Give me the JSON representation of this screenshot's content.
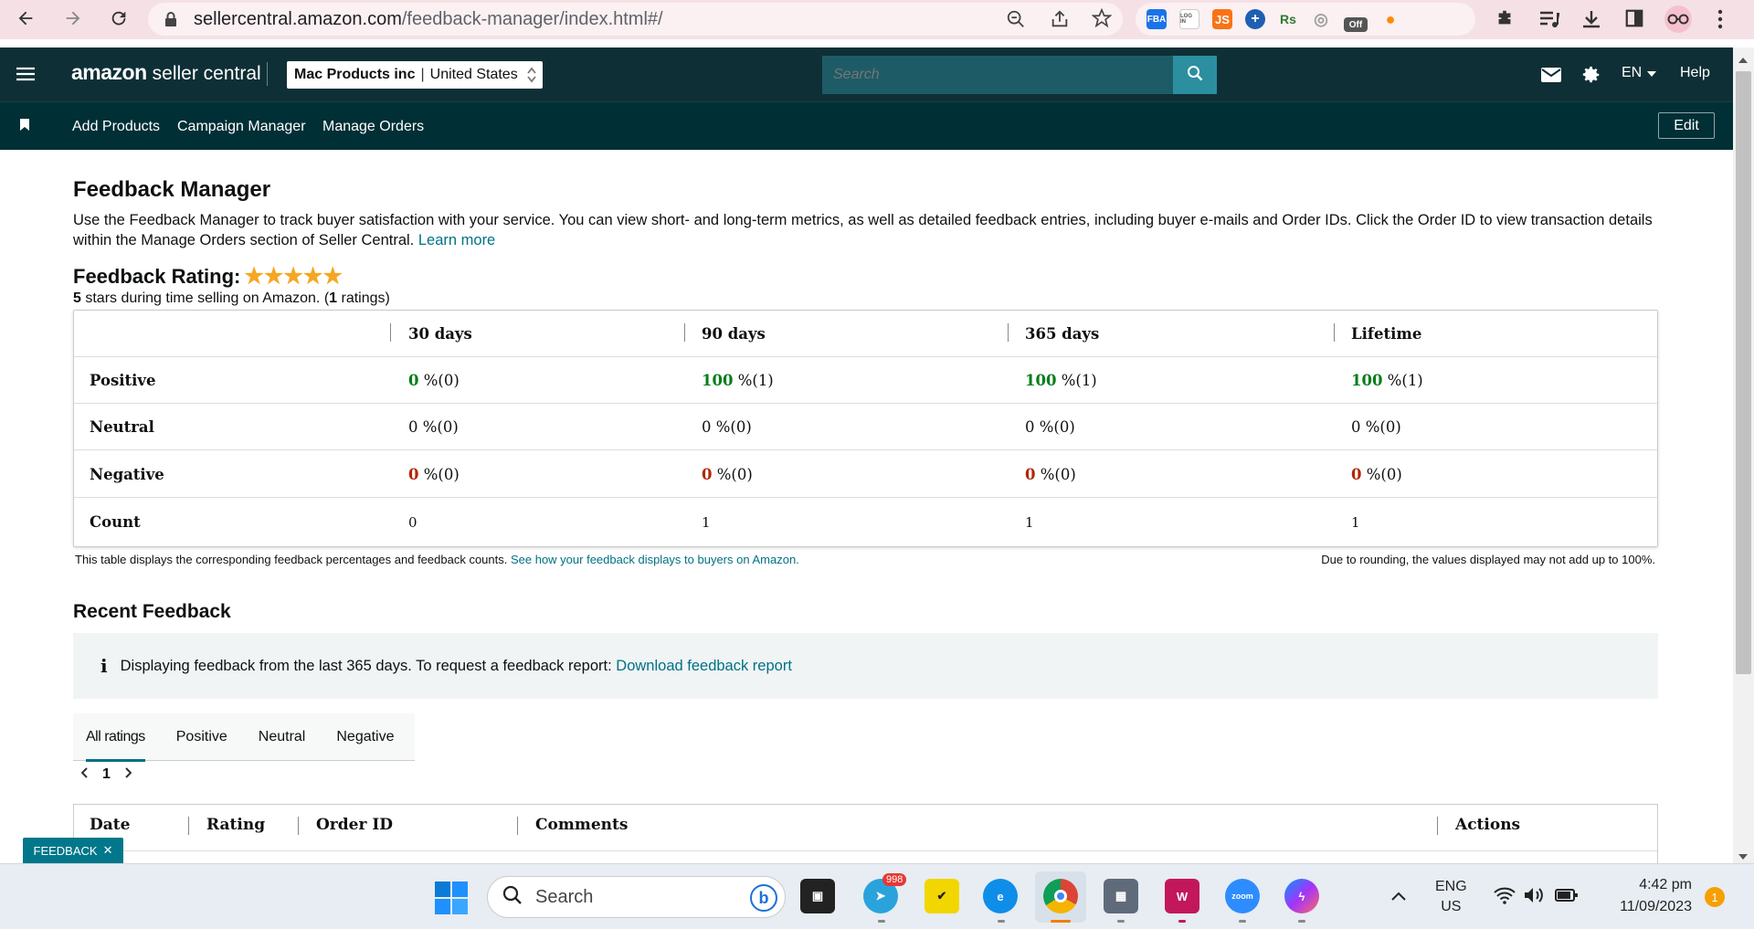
{
  "browser": {
    "url_host": "sellercentral.amazon.com",
    "url_path": "/feedback-manager/index.html#/",
    "extensions": [
      {
        "name": "fba-extension-icon",
        "label": "FBA",
        "color": "#1a73e8"
      },
      {
        "name": "login-extension-icon",
        "label": "LOG IN",
        "color": "#555555"
      },
      {
        "name": "js-extension-icon",
        "label": "JS",
        "color": "#f97316"
      },
      {
        "name": "plus-extension-icon",
        "label": "+",
        "color": "#1e5fb3"
      },
      {
        "name": "rs-extension-icon",
        "label": "Rs",
        "color": "#2e7d32"
      },
      {
        "name": "camera-extension-icon",
        "label": "◎",
        "color": "#9e9e9e"
      },
      {
        "name": "coffee-extension-icon",
        "label": "Off",
        "color": "#555555"
      },
      {
        "name": "orange-extension-icon",
        "label": "●",
        "color": "#ff8a00"
      }
    ]
  },
  "header": {
    "logo_main": "amazon",
    "logo_sub": "seller central",
    "account_name": "Mac Products inc",
    "account_region": "United States",
    "search_placeholder": "Search",
    "language": "EN",
    "help": "Help"
  },
  "subnav": {
    "items": [
      "Add Products",
      "Campaign Manager",
      "Manage Orders"
    ],
    "edit": "Edit"
  },
  "page": {
    "title": "Feedback Manager",
    "description": "Use the Feedback Manager to track buyer satisfaction with your service. You can view short- and long-term metrics, as well as detailed feedback entries, including buyer e-mails and Order IDs. Click the Order ID to view transaction details within the Manage Orders section of Seller Central.",
    "learn_more": "Learn more",
    "rating_label": "Feedback Rating:",
    "rating_stars": 5,
    "rating_sub_count": "5",
    "rating_sub_mid": " stars during time selling on Amazon. (",
    "rating_sub_ratings": "1",
    "rating_sub_end": " ratings)"
  },
  "metrics": {
    "columns": [
      "30 days",
      "90 days",
      "365 days",
      "Lifetime"
    ],
    "rows": [
      {
        "label": "Positive",
        "values": [
          [
            "0",
            " %(0)"
          ],
          [
            "100",
            " %(1)"
          ],
          [
            "100",
            " %(1)"
          ],
          [
            "100",
            " %(1)"
          ]
        ],
        "highlight": "green"
      },
      {
        "label": "Neutral",
        "values": [
          [
            "0",
            " %(0)"
          ],
          [
            "0",
            " %(0)"
          ],
          [
            "0",
            " %(0)"
          ],
          [
            "0",
            " %(0)"
          ]
        ],
        "highlight": "none"
      },
      {
        "label": "Negative",
        "values": [
          [
            "0",
            " %(0)"
          ],
          [
            "0",
            " %(0)"
          ],
          [
            "0",
            " %(0)"
          ],
          [
            "0",
            " %(0)"
          ]
        ],
        "highlight": "red"
      },
      {
        "label": "Count",
        "values": [
          [
            "0",
            ""
          ],
          [
            "1",
            ""
          ],
          [
            "1",
            ""
          ],
          [
            "1",
            ""
          ]
        ],
        "highlight": "none"
      }
    ],
    "note_left": "This table displays the corresponding feedback percentages and feedback counts.",
    "note_link": "See how your feedback displays to buyers on Amazon.",
    "note_right": "Due to rounding, the values displayed may not add up to 100%."
  },
  "recent": {
    "title": "Recent Feedback",
    "info_text": "Displaying feedback from the last 365 days. To request a feedback report:",
    "info_link": "Download feedback report",
    "tabs": [
      "All ratings",
      "Positive",
      "Neutral",
      "Negative"
    ],
    "page": "1",
    "table_headers": [
      "Date",
      "Rating",
      "Order ID",
      "Comments",
      "Actions"
    ]
  },
  "feedback_button": "FEEDBACK",
  "taskbar": {
    "search": "Search",
    "telegram_badge": "998",
    "lang_top": "ENG",
    "lang_bottom": "US",
    "time": "4:42 pm",
    "date": "11/09/2023",
    "notifications": "1"
  }
}
